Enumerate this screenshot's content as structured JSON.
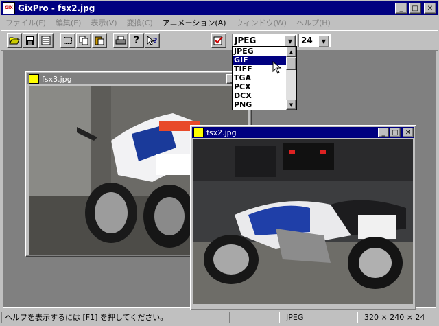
{
  "app": {
    "title": "GixPro - fsx2.jpg",
    "icon_label": "GIX"
  },
  "menu": {
    "items": [
      {
        "label": "ファイル(F)",
        "active": false
      },
      {
        "label": "編集(E)",
        "active": false
      },
      {
        "label": "表示(V)",
        "active": false
      },
      {
        "label": "変換(C)",
        "active": false
      },
      {
        "label": "アニメーション(A)",
        "active": true
      },
      {
        "label": "ウィンドウ(W)",
        "active": false
      },
      {
        "label": "ヘルプ(H)",
        "active": false
      }
    ]
  },
  "toolbar": {
    "format_selected": "JPEG",
    "depth_selected": "24",
    "icons": [
      "open-folder-icon",
      "save-icon",
      "document-icon",
      "select-rect-icon",
      "copy-icon",
      "paste-icon",
      "print-icon",
      "help-icon",
      "context-help-icon",
      "convert-icon"
    ]
  },
  "format_dropdown": {
    "options": [
      "JPEG",
      "GIF",
      "TIFF",
      "TGA",
      "PCX",
      "DCX",
      "PNG"
    ],
    "highlighted": "GIF"
  },
  "windows": [
    {
      "title": "fsx3.jpg",
      "active": false
    },
    {
      "title": "fsx2.jpg",
      "active": true
    }
  ],
  "status": {
    "help_text": "ヘルプを表示するには [F1] を押してください。",
    "format": "JPEG",
    "dimensions": "320 × 240 × 24"
  },
  "colors": {
    "title_active": "#000080",
    "face": "#c0c0c0",
    "workspace": "#808080"
  }
}
